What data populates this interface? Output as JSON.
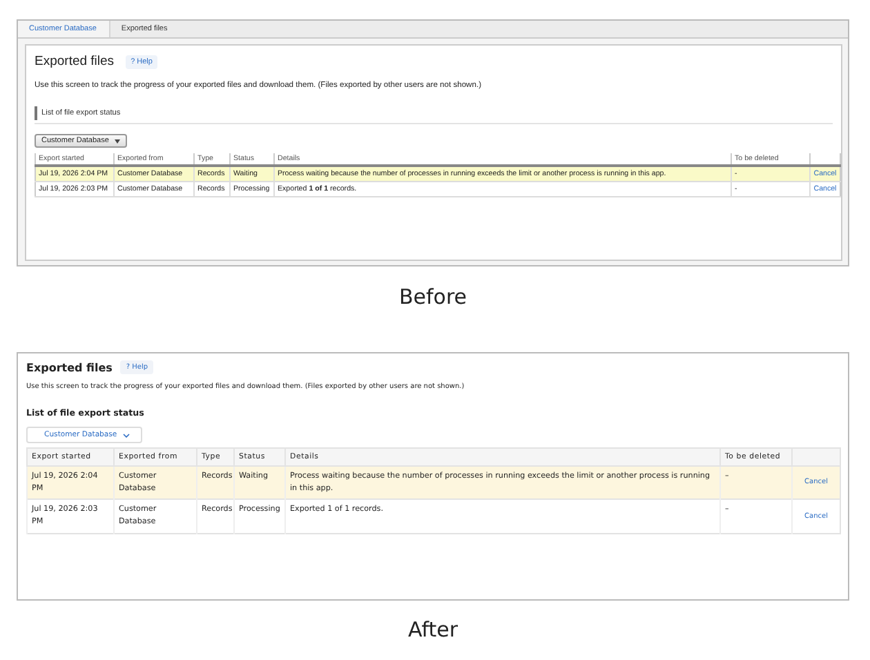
{
  "panels": [
    {
      "kind": "classic",
      "breadcrumb": [
        {
          "label": "Customer Database",
          "kind": "link"
        },
        {
          "label": "Exported files",
          "kind": "current"
        }
      ],
      "title": "Exported files",
      "help": "? Help",
      "description": "Use this screen to track the progress of your exported files and download them. (Files exported by other users are not shown.)",
      "section_title": "List of file export status",
      "filter": {
        "value": "Customer Database"
      },
      "table": {
        "columns": [
          "Export started",
          "Exported from",
          "Type",
          "Status",
          "Details",
          "To be deleted"
        ],
        "rows": [
          {
            "highlighted": true,
            "cells": [
              "Jul 19, 2026 2:04 PM",
              "Customer Database",
              "Records",
              "Waiting",
              "Process waiting because the number of processes in running exceeds the limit or another process is running in this app.",
              "-"
            ],
            "action": "Cancel"
          },
          {
            "highlighted": false,
            "cells": [
              "Jul 19, 2026 2:03 PM",
              "Customer Database",
              "Records",
              "Processing",
              "Exported **1 of 1** records.",
              "-"
            ],
            "action": "Cancel"
          }
        ]
      },
      "caption": "Before"
    },
    {
      "kind": "modern",
      "title": "Exported files",
      "help": "? Help",
      "description": "Use this screen to track the progress of your exported files and download them. (Files exported by other users are not shown.)",
      "section_title": "List of file export status",
      "filter": {
        "value": "Customer Database"
      },
      "table": {
        "columns": [
          "Export started",
          "Exported from",
          "Type",
          "Status",
          "Details",
          "To be deleted"
        ],
        "rows": [
          {
            "highlighted": true,
            "cells": [
              "Jul 19, 2026 2:04 PM",
              "Customer Database",
              "Records",
              "Waiting",
              "Process waiting because the number of processes in running exceeds the limit or another process is running in this app.",
              "–"
            ],
            "action": "Cancel"
          },
          {
            "highlighted": false,
            "cells": [
              "Jul 19, 2026 2:03 PM",
              "Customer Database",
              "Records",
              "Processing",
              "Exported 1 of 1 records.",
              "–"
            ],
            "action": "Cancel"
          }
        ]
      },
      "caption": "After"
    }
  ]
}
